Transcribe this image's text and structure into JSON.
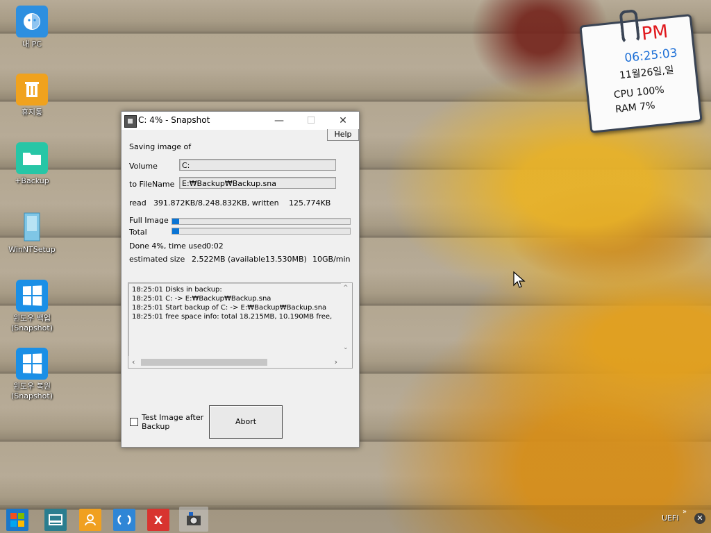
{
  "desktop": {
    "icons": [
      {
        "label": "내 PC",
        "icon": "computer-icon"
      },
      {
        "label": "휴지통",
        "icon": "recycle-bin-icon"
      },
      {
        "label": "+Backup",
        "icon": "folder-icon"
      },
      {
        "label": "WinNTSetup",
        "icon": "setup-icon"
      },
      {
        "label": "윈도우 백업",
        "label2": "(Snapshot)",
        "icon": "windows-logo-icon"
      },
      {
        "label": "윈도우 복원",
        "label2": "(Snapshot)",
        "icon": "windows-logo-icon"
      }
    ]
  },
  "gadget": {
    "ampm": "PM",
    "time": "06:25:03",
    "date": "11월26일,일",
    "cpu": "CPU  100%",
    "ram": "RAM  7%"
  },
  "window": {
    "title": "C: 4% - Snapshot",
    "help_label": "Help",
    "heading": "Saving image of",
    "volume_label": "Volume",
    "volume_value": "C:",
    "filename_label": "to FileName",
    "filename_value": "E:₩Backup₩Backup.sna",
    "read_label": "read",
    "read_value": "391.872KB/8.248.832KB, written",
    "written_value": "125.774KB",
    "full_image_label": "Full Image",
    "total_label": "Total",
    "full_image_progress": 0.04,
    "total_progress": 0.04,
    "done_text": "Done 4%, time used",
    "time_used": "0:02",
    "est_label": "estimated size",
    "est_value": "2.522MB (available",
    "available_value": "13.530MB)",
    "speed_value": "10GB/min",
    "log_lines": [
      "18:25:01 Disks in backup:",
      "18:25:01     C: -> E:₩Backup₩Backup.sna",
      "18:25:01 Start backup of C: -> E:₩Backup₩Backup.sna",
      "18:25:01 free space info: total    18.215MB,    10.190MB free,"
    ],
    "test_image_label_1": "Test Image after",
    "test_image_label_2": "Backup",
    "abort_label": "Abort"
  },
  "taskbar": {
    "tray_text": "UEFI",
    "accent_colors": [
      "#1b77c9",
      "#2a7d8f",
      "#f0a020",
      "#2f86d6",
      "#d8342f"
    ]
  }
}
